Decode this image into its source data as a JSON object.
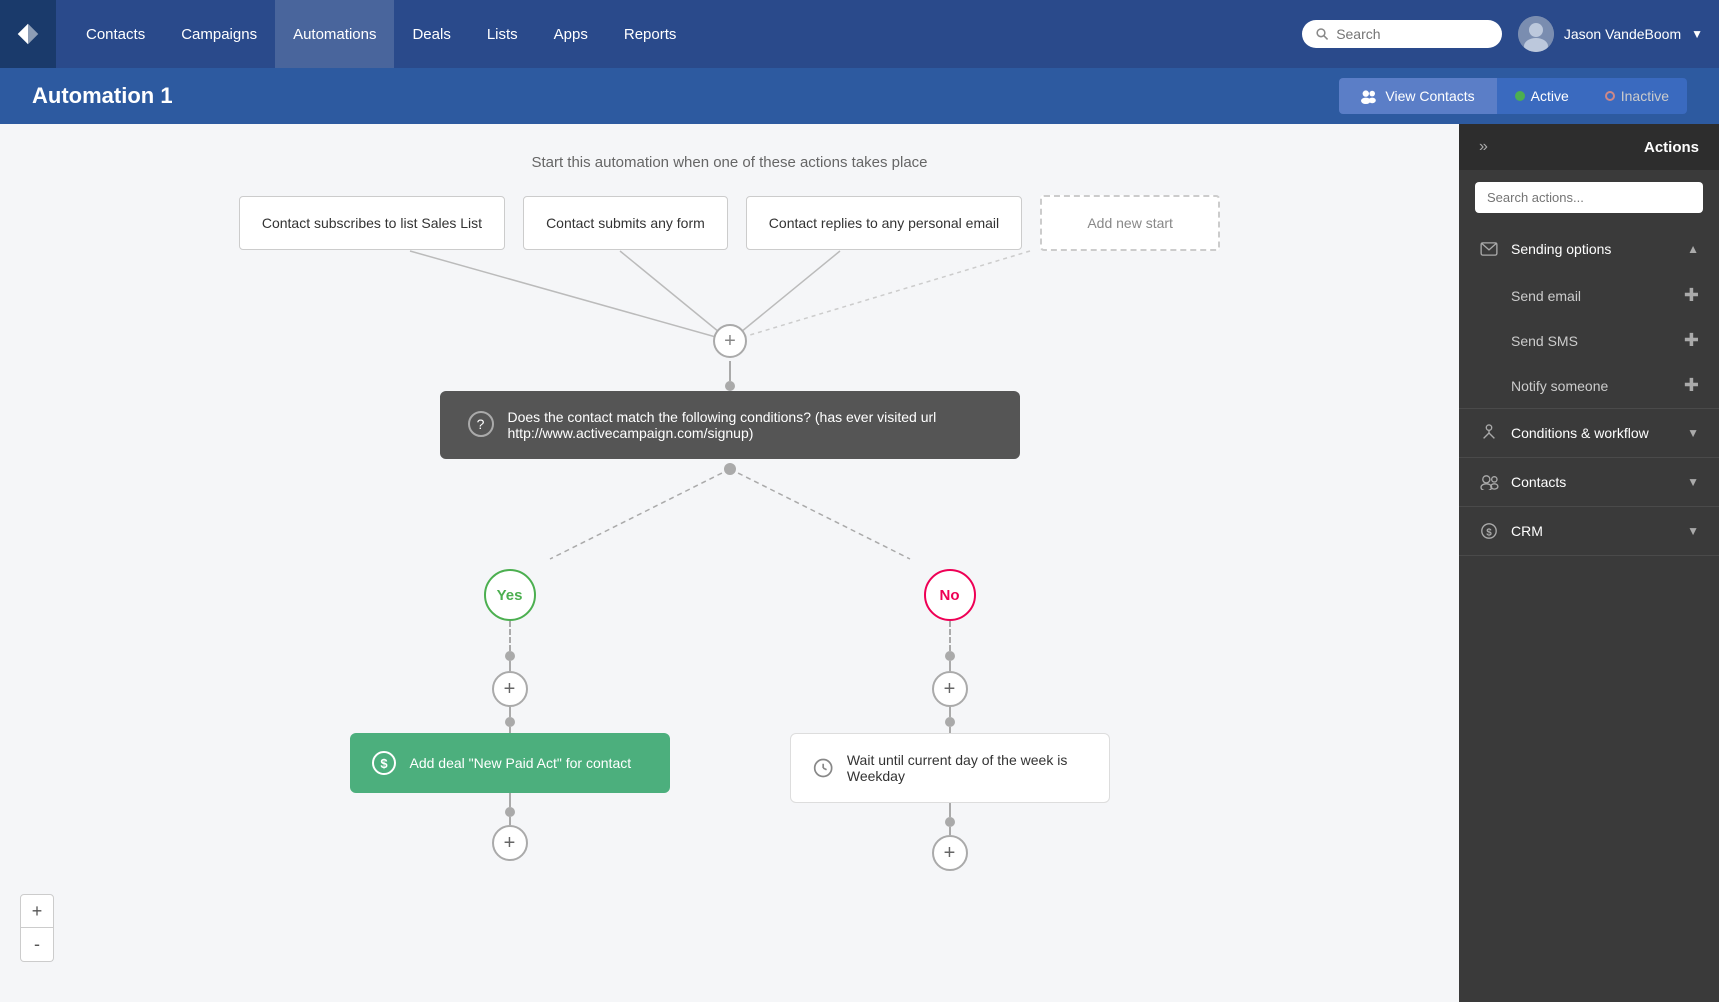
{
  "nav": {
    "logo_label": "ActiveCampaign",
    "items": [
      "Contacts",
      "Campaigns",
      "Automations",
      "Deals",
      "Lists",
      "Apps",
      "Reports"
    ],
    "search_placeholder": "Search",
    "user_name": "Jason VandeBoom"
  },
  "header": {
    "title": "Automation 1",
    "view_contacts_label": "View Contacts",
    "active_label": "Active",
    "inactive_label": "Inactive"
  },
  "canvas": {
    "start_label": "Start this automation when one of these actions takes place",
    "triggers": [
      "Contact subscribes to list Sales List",
      "Contact submits any form",
      "Contact replies to any personal email"
    ],
    "add_trigger_label": "Add new start",
    "plus_button": "+",
    "condition": {
      "text": "Does the contact match the following conditions? (has ever visited url http://www.activecampaign.com/signup)"
    },
    "yes_label": "Yes",
    "no_label": "No",
    "action_yes": "Add deal \"New Paid Act\" for contact",
    "action_no": "Wait until current day of the week is Weekday"
  },
  "sidebar": {
    "title": "Actions",
    "search_placeholder": "Search actions...",
    "sections": [
      {
        "id": "sending-options",
        "icon": "email-icon",
        "label": "Sending options",
        "expanded": true,
        "items": [
          "Send email",
          "Send SMS",
          "Notify someone"
        ]
      },
      {
        "id": "conditions-workflow",
        "icon": "branch-icon",
        "label": "Conditions & workflow",
        "expanded": false,
        "items": []
      },
      {
        "id": "contacts",
        "icon": "contacts-icon",
        "label": "Contacts",
        "expanded": false,
        "items": []
      },
      {
        "id": "crm",
        "icon": "crm-icon",
        "label": "CRM",
        "expanded": false,
        "items": []
      }
    ],
    "collapse_icon": "»"
  },
  "zoom": {
    "in_label": "+",
    "out_label": "-"
  }
}
